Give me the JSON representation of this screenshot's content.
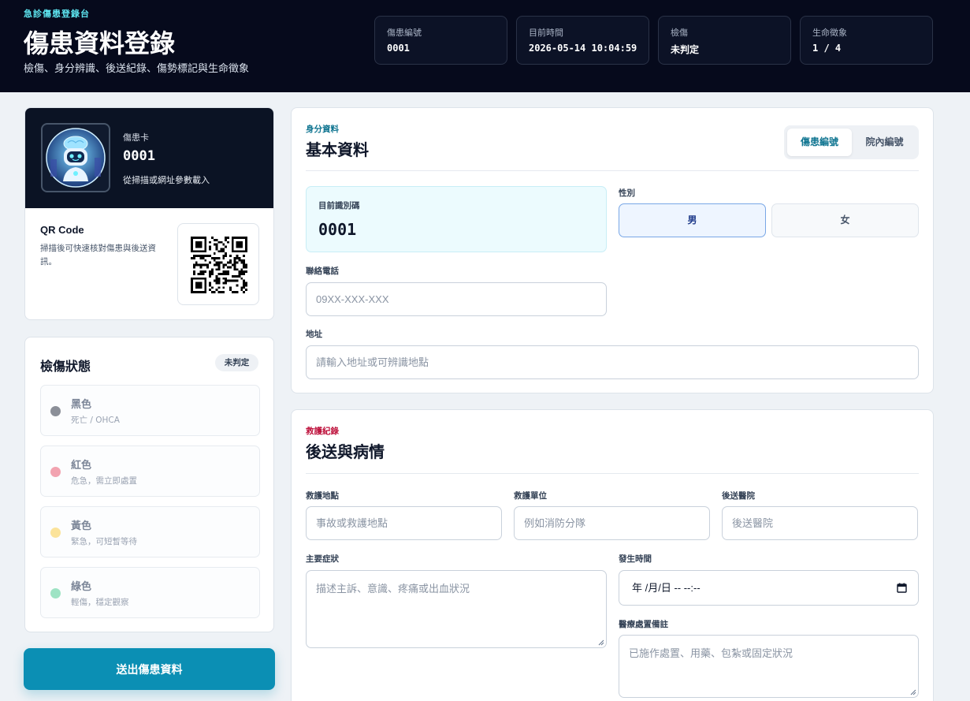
{
  "header": {
    "kicker": "急診傷患登錄台",
    "title": "傷患資料登錄",
    "subtitle": "檢傷、身分辨識、後送紀錄、傷勢標記與生命徵象",
    "stats": [
      {
        "label": "傷患編號",
        "value": "0001"
      },
      {
        "label": "目前時間",
        "value": "2026-05-14 10:04:59"
      },
      {
        "label": "檢傷",
        "value": "未判定"
      },
      {
        "label": "生命徵象",
        "value": "1 / 4"
      }
    ]
  },
  "patient_card": {
    "label": "傷患卡",
    "id": "0001",
    "hint": "從掃描或網址參數載入",
    "avatar_icon": "robot-avatar-icon",
    "qr_title": "QR Code",
    "qr_desc": "掃描後可快速核對傷患與後送資訊。"
  },
  "triage": {
    "title": "檢傷狀態",
    "badge": "未判定",
    "levels": [
      {
        "name": "黑色",
        "desc": "死亡 / OHCA",
        "color": "#8b8f98"
      },
      {
        "name": "紅色",
        "desc": "危急，需立即處置",
        "color": "#f2a3b0"
      },
      {
        "name": "黃色",
        "desc": "緊急，可短暫等待",
        "color": "#fbe39a"
      },
      {
        "name": "綠色",
        "desc": "輕傷，穩定觀察",
        "color": "#9ee3c4"
      }
    ]
  },
  "submit_label": "送出傷患資料",
  "basic": {
    "kicker": "身分資料",
    "kicker_color": "#0e7490",
    "title": "基本資料",
    "id_tabs": [
      "傷患編號",
      "院內編號"
    ],
    "current_id_label": "目前識別碼",
    "current_id": "0001",
    "gender_label": "性別",
    "gender_options": [
      "男",
      "女"
    ],
    "phone_label": "聯絡電話",
    "phone_placeholder": "09XX-XXX-XXX",
    "address_label": "地址",
    "address_placeholder": "請輸入地址或可辨識地點"
  },
  "transport": {
    "kicker": "救護紀錄",
    "kicker_color": "#be123c",
    "title": "後送與病情",
    "rescue_site_label": "救護地點",
    "rescue_site_placeholder": "事故或救護地點",
    "rescue_unit_label": "救護單位",
    "rescue_unit_placeholder": "例如消防分隊",
    "hospital_label": "後送醫院",
    "hospital_placeholder": "後送醫院",
    "symptom_label": "主要症狀",
    "symptom_placeholder": "描述主訴、意識、疼痛或出血狀況",
    "time_label": "發生時間",
    "time_placeholder": "年 /月/日 -- --:--",
    "treatment_label": "醫療處置備註",
    "treatment_placeholder": "已施作處置、用藥、包紮或固定狀況"
  }
}
